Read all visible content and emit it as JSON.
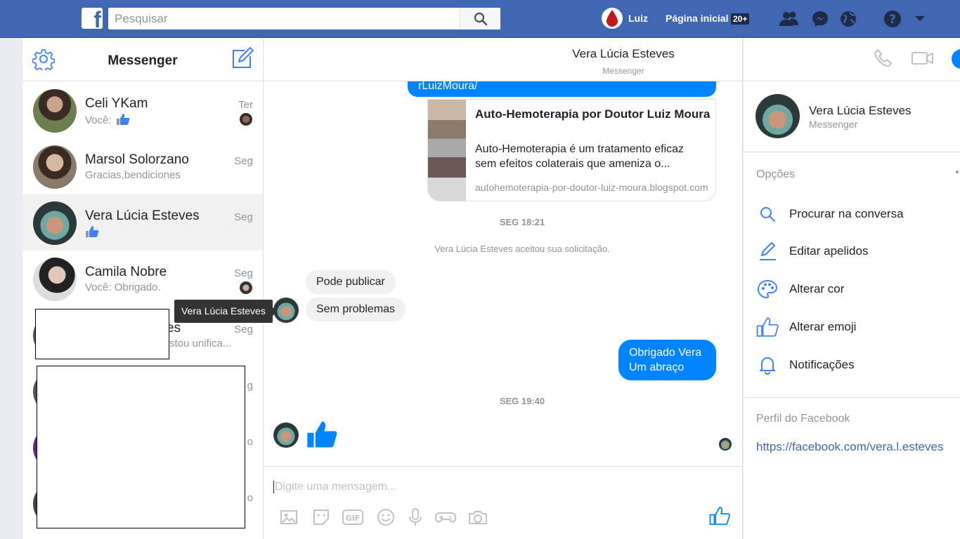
{
  "topbar": {
    "logo": "f",
    "search_placeholder": "Pesquisar",
    "user_name": "Luiz",
    "home_label": "Página inicial",
    "home_badge": "20+",
    "icons": [
      "friends-icon",
      "messenger-icon",
      "globe-icon",
      "help-icon",
      "chevron-down-icon"
    ]
  },
  "inbox": {
    "title": "Messenger",
    "threads": [
      {
        "name": "Celi YKam",
        "snippet": "Você:",
        "time": "Ter"
      },
      {
        "name": "Marsol Solorzano",
        "snippet": "Gracias,bendiciones",
        "time": "Seg"
      },
      {
        "name": "Vera Lúcia Esteves",
        "snippet": "",
        "time": "Seg"
      },
      {
        "name": "Camila Nobre",
        "snippet": "Você: Obrigado.",
        "time": "Seg"
      },
      {
        "name": "es",
        "snippet": "stou unifica...",
        "time": "Seg"
      },
      {
        "time_partial_1": "g",
        "time_partial_2": "o",
        "time_partial_3": "o"
      }
    ]
  },
  "tooltip": "Vera Lúcia Esteves",
  "conversation": {
    "title": "Vera Lúcia Esteves",
    "subtitle": "Messenger",
    "link_bubble_text": "rLuizMoura/",
    "link_card": {
      "title": "Auto-Hemoterapia por Doutor Luiz Moura",
      "description": "Auto-Hemoterapia é um tratamento eficaz sem efeitos colaterais que ameniza o...",
      "url": "autohemoterapia-por-doutor-luiz-moura.blogspot.com"
    },
    "timestamp_1": "SEG 18:21",
    "system_message": "Vera Lúcia Esteves aceitou sua solicitação.",
    "incoming": [
      "Pode publicar",
      "Sem problemas"
    ],
    "outgoing": [
      "Obrigado Vera",
      "Um abraço"
    ],
    "timestamp_2": "SEG 19:40",
    "composer_placeholder": "Digite uma mensagem...",
    "tools": [
      "image-icon",
      "sticker-icon",
      "gif-icon",
      "emoji-icon",
      "microphone-icon",
      "game-icon",
      "camera-icon"
    ]
  },
  "info_panel": {
    "name": "Vera Lúcia Esteves",
    "subtitle": "Messenger",
    "options_heading": "Opções",
    "options": [
      {
        "label": "Procurar na conversa",
        "icon": "search-icon"
      },
      {
        "label": "Editar apelidos",
        "icon": "pencil-icon"
      },
      {
        "label": "Alterar cor",
        "icon": "palette-icon"
      },
      {
        "label": "Alterar emoji",
        "icon": "thumbs-up-icon"
      },
      {
        "label": "Notificações",
        "icon": "bell-icon"
      }
    ],
    "profile_heading": "Perfil do Facebook",
    "profile_url": "https://facebook.com/vera.l.esteves"
  },
  "colors": {
    "facebook_blue": "#4267b2",
    "messenger_blue": "#0084ff",
    "gray_text": "#90949c"
  }
}
